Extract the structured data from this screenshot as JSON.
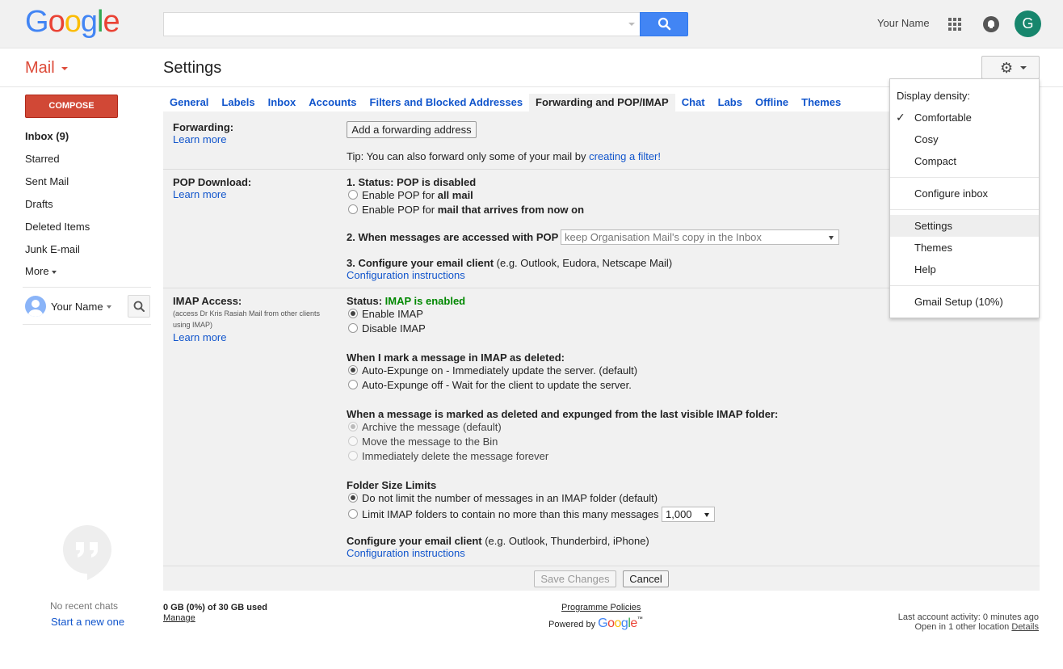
{
  "header": {
    "logo_letters": [
      {
        "ch": "G",
        "color": "#4285f4"
      },
      {
        "ch": "o",
        "color": "#ea4335"
      },
      {
        "ch": "o",
        "color": "#fbbc05"
      },
      {
        "ch": "g",
        "color": "#4285f4"
      },
      {
        "ch": "l",
        "color": "#34a853"
      },
      {
        "ch": "e",
        "color": "#ea4335"
      }
    ],
    "search_value": "",
    "user_name": "Your Name",
    "avatar_letter": "G",
    "avatar_color": "#17866d"
  },
  "subbar": {
    "app_label": "Mail",
    "page_title": "Settings"
  },
  "sidebar": {
    "compose": "COMPOSE",
    "items": [
      {
        "label": "Inbox (9)",
        "bold": true
      },
      {
        "label": "Starred"
      },
      {
        "label": "Sent Mail"
      },
      {
        "label": "Drafts"
      },
      {
        "label": "Deleted Items"
      },
      {
        "label": "Junk E-mail"
      },
      {
        "label": "More"
      }
    ],
    "chat_user": "Your Name",
    "no_chats": "No recent chats",
    "start_new": "Start a new one"
  },
  "tabs": [
    {
      "label": "General"
    },
    {
      "label": "Labels"
    },
    {
      "label": "Inbox"
    },
    {
      "label": "Accounts"
    },
    {
      "label": "Filters and Blocked Addresses"
    },
    {
      "label": "Forwarding and POP/IMAP",
      "active": true
    },
    {
      "label": "Chat"
    },
    {
      "label": "Labs"
    },
    {
      "label": "Offline"
    },
    {
      "label": "Themes"
    }
  ],
  "forwarding": {
    "label": "Forwarding:",
    "learn_more": "Learn more",
    "add_button": "Add a forwarding address",
    "tip_prefix": "Tip: You can also forward only some of your mail by ",
    "tip_link": "creating a filter!"
  },
  "pop": {
    "label": "POP Download:",
    "learn_more": "Learn more",
    "status_heading": "1. Status: POP is disabled",
    "option1_prefix": "Enable POP for ",
    "option1_bold": "all mail",
    "option2_prefix": "Enable POP for ",
    "option2_bold": "mail that arrives from now on",
    "accessed_heading": "2. When messages are accessed with POP",
    "accessed_value": "keep  Organisation  Mail's copy in the Inbox",
    "configure_heading": "3. Configure your email client",
    "configure_hint": " (e.g. Outlook, Eudora, Netscape Mail)",
    "configure_link": "Configuration instructions"
  },
  "imap": {
    "label": "IMAP Access:",
    "sub_label": "(access Dr Kris Rasiah Mail from other clients using IMAP)",
    "learn_more": "Learn more",
    "status_prefix": "Status: ",
    "status_value": "IMAP is enabled",
    "enable": "Enable IMAP",
    "disable": "Disable IMAP",
    "deleted_heading": "When I mark a message in IMAP as deleted:",
    "deleted_opt1": "Auto-Expunge on - Immediately update the server. (default)",
    "deleted_opt2": "Auto-Expunge off - Wait for the client to update the server.",
    "expunged_heading": "When a message is marked as deleted and expunged from the last visible IMAP folder:",
    "expunged_opt1": "Archive the message (default)",
    "expunged_opt2": "Move the message to the Bin",
    "expunged_opt3": "Immediately delete the message forever",
    "folder_heading": "Folder Size Limits",
    "folder_opt1": "Do not limit the number of messages in an IMAP folder (default)",
    "folder_opt2": "Limit IMAP folders to contain no more than this many messages",
    "folder_limit_value": "1,000",
    "configure_heading": "Configure your email client",
    "configure_hint": " (e.g. Outlook, Thunderbird, iPhone)",
    "configure_link": "Configuration instructions"
  },
  "actions": {
    "save": "Save Changes",
    "cancel": "Cancel"
  },
  "footer": {
    "storage": "0 GB (0%) of 30 GB used",
    "manage": "Manage",
    "policies": "Programme Policies",
    "powered_by": "Powered by",
    "activity": "Last account activity: 0 minutes ago",
    "open_in": "Open in 1 other location",
    "details": "Details"
  },
  "menu": {
    "header": "Display density:",
    "items": [
      {
        "label": "Comfortable",
        "checked": true
      },
      {
        "label": "Cosy"
      },
      {
        "label": "Compact"
      },
      {
        "label": "Configure inbox"
      },
      {
        "label": "Settings",
        "hover": true
      },
      {
        "label": "Themes"
      },
      {
        "label": "Help"
      },
      {
        "label": "Gmail Setup (10%)"
      }
    ]
  }
}
